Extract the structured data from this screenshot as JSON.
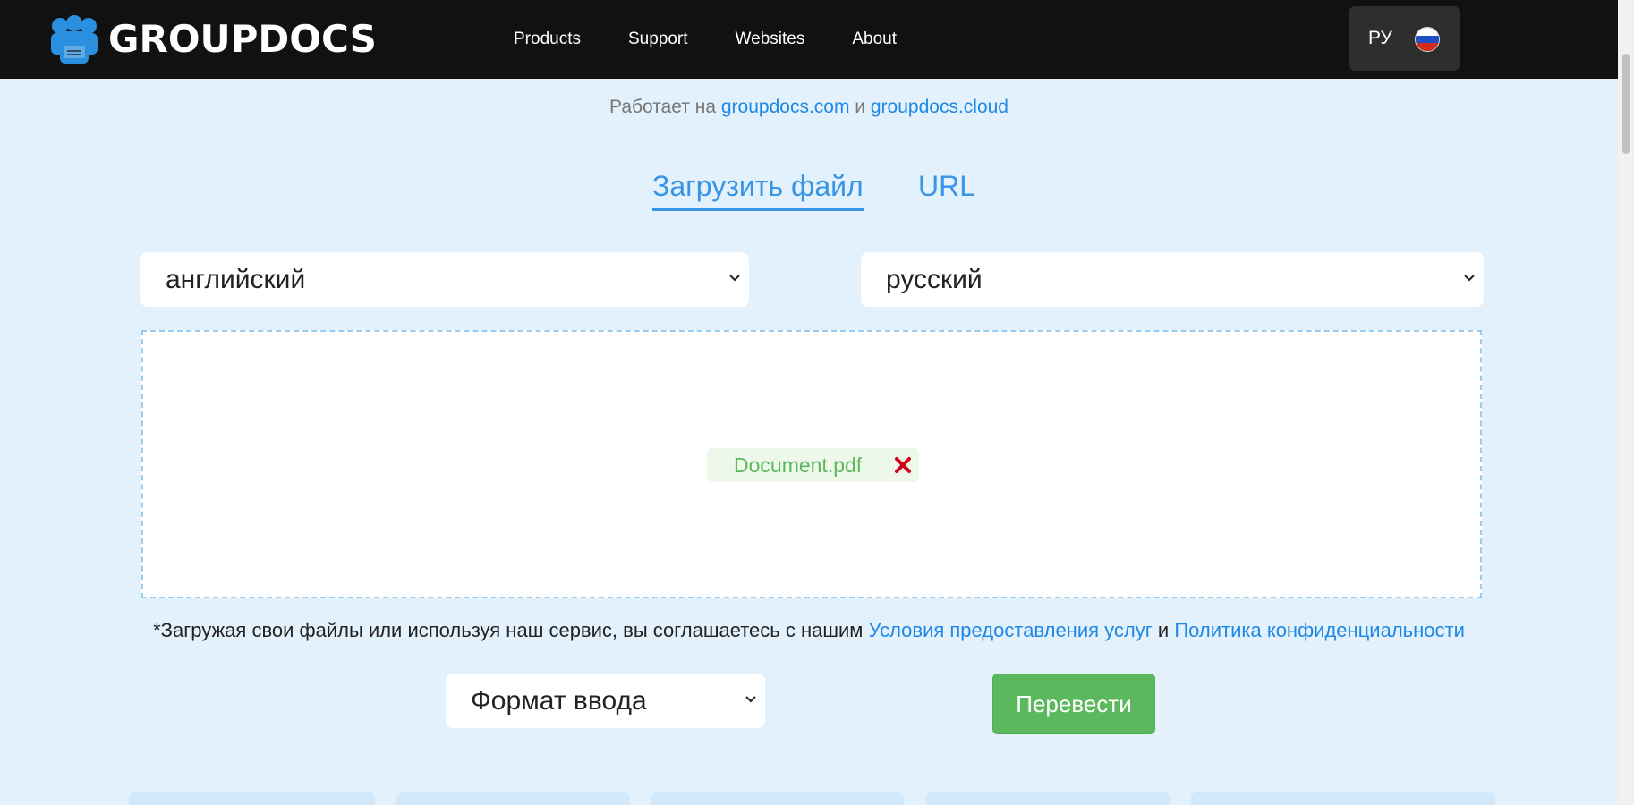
{
  "header": {
    "logo_text": "GROUPDOCS",
    "nav": [
      "Products",
      "Support",
      "Websites",
      "About"
    ],
    "lang_label": "РУ"
  },
  "powered": {
    "prefix": "Работает на",
    "link1": "groupdocs.com",
    "conj": "и",
    "link2": "groupdocs.cloud"
  },
  "tabs": {
    "upload": "Загрузить файл",
    "url": "URL"
  },
  "languages": {
    "from": "английский",
    "to": "русский"
  },
  "dropzone": {
    "file_name": "Document.pdf"
  },
  "terms": {
    "text": "*Загружая свои файлы или используя наш сервис, вы соглашаетесь с нашим",
    "tos": "Условия предоставления услуг",
    "conj": "и",
    "privacy": "Политика конфиденциальности"
  },
  "format_select": "Формат ввода",
  "translate_button": "Перевести",
  "colors": {
    "accent": "#1e88e5",
    "success": "#5cb85c",
    "danger": "#d0021b",
    "background": "#e3f1fc",
    "header": "#111111"
  },
  "icons": [
    "groupdocs-logo-icon",
    "russia-flag-icon",
    "chevron-down-icon",
    "remove-file-icon"
  ]
}
